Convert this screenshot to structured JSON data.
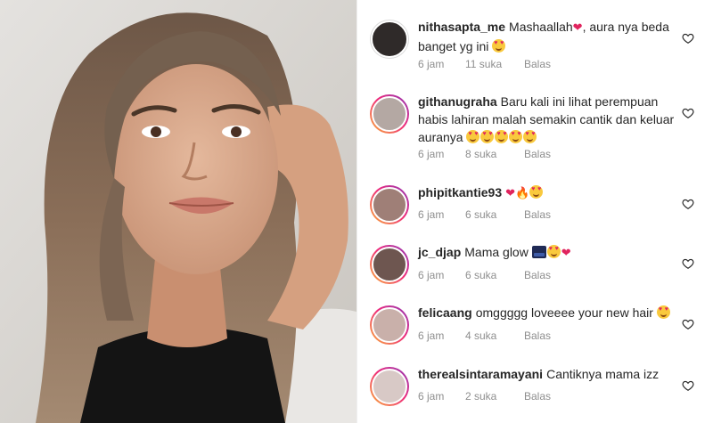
{
  "post": {
    "photo_alt": "selfie"
  },
  "comments": [
    {
      "username": "nithasapta_me",
      "text": "Mashaallah",
      "emojis_after_text": [
        "heart"
      ],
      "text2": ", aura nya beda banget yg ini",
      "emojis_end": [
        "heart-eyes"
      ],
      "time": "6 jam",
      "likes": "11 suka",
      "reply": "Balas",
      "avatar_ring": false
    },
    {
      "username": "githanugraha",
      "text": "Baru kali ini lihat perempuan habis lahiran malah semakin cantik dan keluar auranya",
      "emojis_end": [
        "heart-eyes",
        "heart-eyes",
        "heart-eyes",
        "heart-eyes",
        "heart-eyes"
      ],
      "time": "6 jam",
      "likes": "8 suka",
      "reply": "Balas",
      "avatar_ring": true
    },
    {
      "username": "phipitkantie93",
      "text": "",
      "emojis_end": [
        "heart",
        "fire",
        "heart-eyes"
      ],
      "time": "6 jam",
      "likes": "6 suka",
      "reply": "Balas",
      "avatar_ring": true
    },
    {
      "username": "jc_djap",
      "text": "Mama glow",
      "emojis_end": [
        "night-sky",
        "heart-eyes",
        "heart"
      ],
      "time": "6 jam",
      "likes": "6 suka",
      "reply": "Balas",
      "avatar_ring": true
    },
    {
      "username": "felicaang",
      "text": "omggggg loveeee your new hair",
      "emojis_end": [
        "heart-eyes"
      ],
      "time": "6 jam",
      "likes": "4 suka",
      "reply": "Balas",
      "avatar_ring": true
    },
    {
      "username": "therealsintaramayani",
      "text": "Cantiknya mama izz",
      "emojis_end": [],
      "time": "6 jam",
      "likes": "2 suka",
      "reply": "Balas",
      "avatar_ring": true
    }
  ],
  "colors": {
    "text": "#262626",
    "meta": "#8e8e8e",
    "heart_emoji": "#e0245e",
    "ring_start": "#f9b13a",
    "ring_mid": "#ee2a7b",
    "ring_end": "#8a3ab9"
  },
  "icons": {
    "like": "heart-outline-icon"
  }
}
